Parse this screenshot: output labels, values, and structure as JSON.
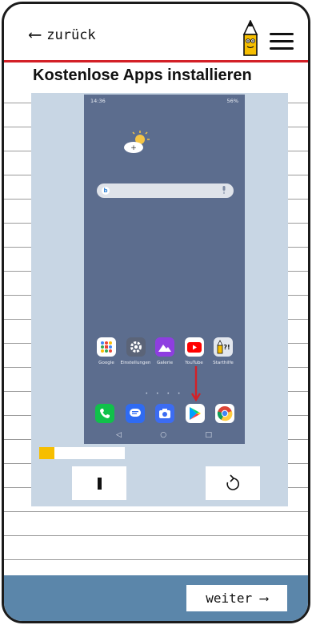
{
  "header": {
    "back_label": "zurück",
    "back_arrow": "⟵",
    "logo_icon": "pencil-mascot-icon",
    "menu_icon": "hamburger-menu-icon"
  },
  "title": "Kostenlose Apps installieren",
  "phone": {
    "status_time": "14:36",
    "status_right": "56%",
    "search_icon": "bing-search-icon",
    "apps": [
      {
        "label": "Google",
        "icon": "google-folder-icon"
      },
      {
        "label": "Einstellungen",
        "icon": "settings-gear-icon"
      },
      {
        "label": "Galerie",
        "icon": "gallery-icon"
      },
      {
        "label": "YouTube",
        "icon": "youtube-icon"
      },
      {
        "label": "Starthilfe",
        "icon": "starthilfe-icon"
      }
    ],
    "dock": [
      "phone-icon",
      "messages-icon",
      "camera-icon",
      "play-store-icon",
      "chrome-icon"
    ],
    "nav": [
      "◁",
      "○",
      "□"
    ]
  },
  "video": {
    "progress": 0.18,
    "pause_icon": "pause-icon",
    "replay_icon": "replay-icon"
  },
  "footer": {
    "next_label": "weiter",
    "next_arrow": "⟶"
  },
  "colors": {
    "accent_red": "#d32027",
    "progress_yellow": "#f6be00",
    "footer_blue": "#5b86aa",
    "panel_blue": "#c8d6e4",
    "phone_bg": "#5c6d8e"
  }
}
